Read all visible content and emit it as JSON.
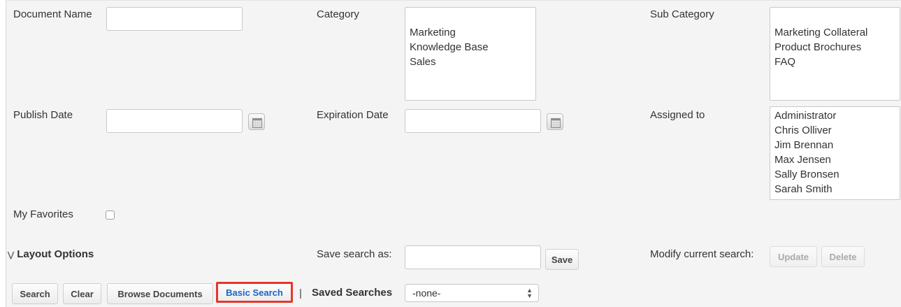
{
  "fields": {
    "document_name_label": "Document Name",
    "category_label": "Category",
    "sub_category_label": "Sub Category",
    "publish_date_label": "Publish Date",
    "expiration_date_label": "Expiration Date",
    "assigned_to_label": "Assigned to",
    "my_favorites_label": "My Favorites"
  },
  "category_options": [
    "Marketing",
    "Knowledge Base",
    "Sales"
  ],
  "sub_category_options": [
    "Marketing Collateral",
    "Product Brochures",
    "FAQ"
  ],
  "assigned_options": [
    "Administrator",
    "Chris Olliver",
    "Jim Brennan",
    "Max Jensen",
    "Sally Bronsen",
    "Sarah Smith"
  ],
  "layout": {
    "layout_options_label": "Layout Options",
    "save_search_label": "Save search as:",
    "save_button": "Save",
    "modify_label": "Modify current search:",
    "update_button": "Update",
    "delete_button": "Delete"
  },
  "actions": {
    "search": "Search",
    "clear": "Clear",
    "browse": "Browse Documents",
    "basic_search": "Basic Search",
    "separator": "|",
    "saved_searches_label": "Saved Searches",
    "saved_searches_value": "-none-"
  },
  "icons": {
    "layout_toggle": "double-chevron-down-icon",
    "calendar": "calendar-icon"
  },
  "colors": {
    "highlight_border": "#e8362a",
    "link_blue": "#1a66c2"
  }
}
